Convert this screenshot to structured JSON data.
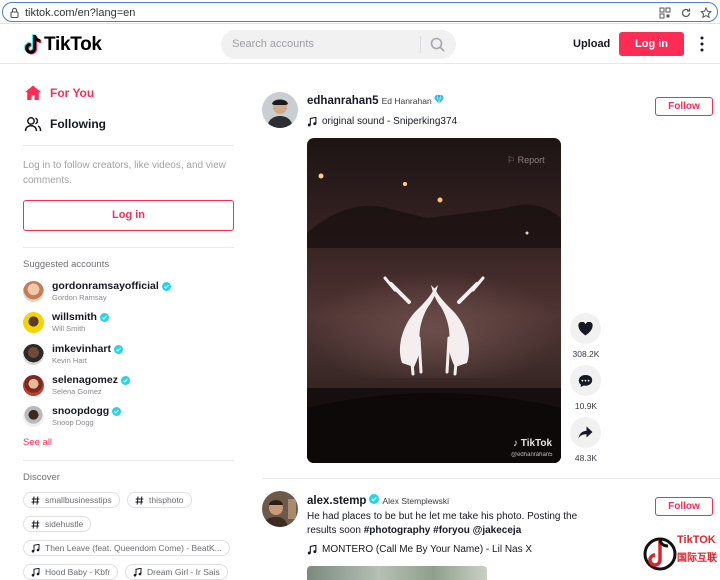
{
  "browser": {
    "url": "tiktok.com/en?lang=en"
  },
  "header": {
    "logo_text": "TikTok",
    "search_placeholder": "Search accounts",
    "upload_label": "Upload",
    "login_label": "Log in"
  },
  "sidebar": {
    "nav": [
      {
        "label": "For You",
        "icon": "home-icon",
        "active": true
      },
      {
        "label": "Following",
        "icon": "users-icon",
        "active": false
      }
    ],
    "login_prompt": "Log in to follow creators, like videos, and view comments.",
    "login_button": "Log in",
    "suggested_title": "Suggested accounts",
    "accounts": [
      {
        "username": "gordonramsayofficial",
        "display_name": "Gordon Ramsay",
        "verified": true
      },
      {
        "username": "willsmith",
        "display_name": "Will Smith",
        "verified": true
      },
      {
        "username": "imkevinhart",
        "display_name": "Kevin Hart",
        "verified": true
      },
      {
        "username": "selenagomez",
        "display_name": "Selena Gomez",
        "verified": true
      },
      {
        "username": "snoopdogg",
        "display_name": "Snoop Dogg",
        "verified": true
      }
    ],
    "see_all": "See all",
    "discover_title": "Discover",
    "tags": [
      {
        "type": "hashtag",
        "label": "smallbusinesstips"
      },
      {
        "type": "hashtag",
        "label": "thisphoto"
      },
      {
        "type": "hashtag",
        "label": "sidehustle"
      },
      {
        "type": "music",
        "label": "Then Leave (feat. Queendom Come) - BeatK..."
      },
      {
        "type": "music",
        "label": "Hood Baby - Kbfr"
      },
      {
        "type": "music",
        "label": "Dream Girl - Ir Sais"
      }
    ]
  },
  "feed": {
    "posts": [
      {
        "username": "edhanrahan5",
        "display_name": "Ed Hanrahan",
        "badge": "diamond-icon",
        "sound": "original sound - Sniperking374",
        "follow_label": "Follow",
        "video_watermark": "TikTok",
        "video_handle": "@edhanrahan5",
        "video_report": "Report",
        "likes": "308.2K",
        "comments": "10.9K",
        "shares": "48.3K"
      },
      {
        "username": "alex.stemp",
        "display_name": "Alex Stemplewski",
        "verified": true,
        "follow_label": "Follow",
        "caption_text": "He had places to be but he let me take his photo. Posting the results soon",
        "caption_tags": "#photography #foryou @jakeceja",
        "sound": "MONTERO (Call Me By Your Name) - Lil Nas X"
      }
    ]
  },
  "watermark": {
    "line1": "TikTOK",
    "line2": "国际互联"
  },
  "colors": {
    "brand": "#fe2c55",
    "verified": "#20d5ec"
  }
}
